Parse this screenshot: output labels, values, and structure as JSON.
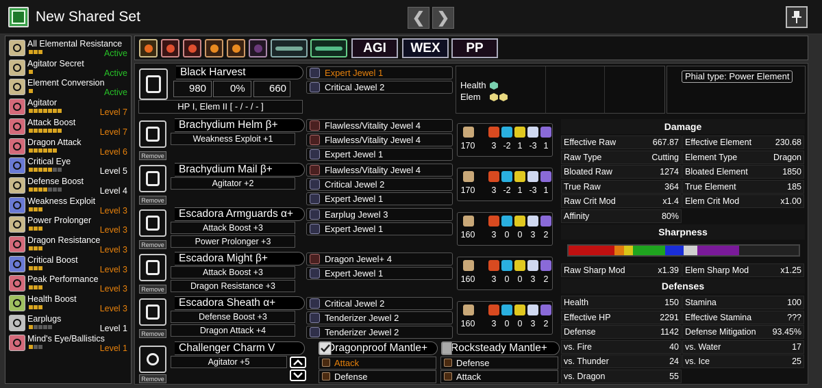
{
  "header": {
    "title": "New Shared Set",
    "prev_label": "❮",
    "next_label": "❯"
  },
  "colors": {
    "active": "#27c127",
    "level": "#e8820c",
    "white": "#ffffff"
  },
  "skills": [
    {
      "name": "All Elemental Resistance",
      "status": "Active",
      "pips": 3,
      "max": 3,
      "icon": "crest-icon",
      "color": "#c9b98a"
    },
    {
      "name": "Agitator Secret",
      "status": "Active",
      "pips": 1,
      "max": 1,
      "icon": "crest-icon",
      "color": "#c9b98a"
    },
    {
      "name": "Element Conversion",
      "status": "Active",
      "pips": 1,
      "max": 1,
      "icon": "crest-icon",
      "color": "#c9b98a"
    },
    {
      "name": "Agitator",
      "status": "Level 7",
      "pips": 7,
      "max": 7,
      "icon": "skill-icon",
      "color": "#d46a7a"
    },
    {
      "name": "Attack Boost",
      "status": "Level 7",
      "pips": 7,
      "max": 7,
      "icon": "skill-icon",
      "color": "#d46a7a"
    },
    {
      "name": "Dragon Attack",
      "status": "Level 6",
      "pips": 6,
      "max": 6,
      "icon": "skill-icon",
      "color": "#d46a7a"
    },
    {
      "name": "Critical Eye",
      "status": "Level 5",
      "pips": 5,
      "max": 7,
      "icon": "skill-icon",
      "color": "#6a7ad4"
    },
    {
      "name": "Defense Boost",
      "status": "Level 4",
      "pips": 4,
      "max": 7,
      "icon": "skill-icon",
      "color": "#c9b98a"
    },
    {
      "name": "Weakness Exploit",
      "status": "Level 3",
      "pips": 3,
      "max": 3,
      "icon": "skill-icon",
      "color": "#6a7ad4"
    },
    {
      "name": "Power Prolonger",
      "status": "Level 3",
      "pips": 3,
      "max": 3,
      "icon": "skill-icon",
      "color": "#c9b98a"
    },
    {
      "name": "Dragon Resistance",
      "status": "Level 3",
      "pips": 3,
      "max": 3,
      "icon": "skill-icon",
      "color": "#d46a7a"
    },
    {
      "name": "Critical Boost",
      "status": "Level 3",
      "pips": 3,
      "max": 3,
      "icon": "skill-icon",
      "color": "#6a7ad4"
    },
    {
      "name": "Peak Performance",
      "status": "Level 3",
      "pips": 3,
      "max": 3,
      "icon": "skill-icon",
      "color": "#d46a7a"
    },
    {
      "name": "Health Boost",
      "status": "Level 3",
      "pips": 3,
      "max": 3,
      "icon": "skill-icon",
      "color": "#a0c060"
    },
    {
      "name": "Earplugs",
      "status": "Level 1",
      "pips": 1,
      "max": 5,
      "icon": "skill-icon",
      "color": "#c0c0c0"
    },
    {
      "name": "Mind's Eye/Ballistics",
      "status": "Level 1",
      "pips": 1,
      "max": 3,
      "icon": "skill-icon",
      "color": "#d46a7a"
    }
  ],
  "tags": [
    "AGI",
    "WEX",
    "PP"
  ],
  "weapon": {
    "name": "Black Harvest",
    "attack": "980",
    "affinity": "0%",
    "element": "660",
    "sharpness_label": "HP I, Elem II [ - / - / - ]",
    "jewels": [
      {
        "label": "Expert Jewel 1",
        "color": "#e8820c"
      },
      {
        "label": "Critical Jewel 2",
        "color": "#ffffff"
      }
    ],
    "health_label": "Health",
    "elem_label": "Elem",
    "phial": "Phial type: Power Element"
  },
  "armor": [
    {
      "name": "Brachydium Helm β+",
      "skills": [
        "Weakness Exploit +1"
      ],
      "jewels": [
        "Flawless/Vitality Jewel 4",
        "Flawless/Vitality Jewel 4",
        "Expert Jewel 1"
      ],
      "res": [
        "170",
        "3",
        "-2",
        "1",
        "-3",
        "1"
      ],
      "remove": "Remove"
    },
    {
      "name": "Brachydium Mail β+",
      "skills": [
        "Agitator +2"
      ],
      "jewels": [
        "Flawless/Vitality Jewel 4",
        "Critical Jewel 2",
        "Expert Jewel 1"
      ],
      "res": [
        "170",
        "3",
        "-2",
        "1",
        "-3",
        "1"
      ],
      "remove": "Remove"
    },
    {
      "name": "Escadora Armguards α+",
      "skills": [
        "Attack Boost +3",
        "Power Prolonger +3"
      ],
      "jewels": [
        "Earplug Jewel 3",
        "Expert Jewel 1"
      ],
      "res": [
        "160",
        "3",
        "0",
        "0",
        "3",
        "2"
      ],
      "remove": "Remove"
    },
    {
      "name": "Escadora Might β+",
      "skills": [
        "Attack Boost +3",
        "Dragon Resistance +3"
      ],
      "jewels": [
        "Dragon Jewel+ 4",
        "Expert Jewel 1"
      ],
      "res": [
        "160",
        "3",
        "0",
        "0",
        "3",
        "2"
      ],
      "remove": "Remove"
    },
    {
      "name": "Escadora Sheath α+",
      "skills": [
        "Defense Boost +3",
        "Dragon Attack +4"
      ],
      "jewels": [
        "Critical Jewel 2",
        "Tenderizer Jewel 2",
        "Tenderizer Jewel 2"
      ],
      "res": [
        "160",
        "3",
        "0",
        "0",
        "3",
        "2"
      ],
      "remove": "Remove"
    }
  ],
  "charm": {
    "name": "Challenger Charm V",
    "skill": "Agitator +5",
    "remove": "Remove"
  },
  "mantles": [
    {
      "name": "Dragonproof Mantle+",
      "items": [
        "Attack",
        "Defense"
      ],
      "color": "#e8820c"
    },
    {
      "name": "Rocksteady Mantle+",
      "items": [
        "Defense",
        "Attack"
      ],
      "color": "#ffffff"
    }
  ],
  "stats": {
    "damage_title": "Damage",
    "damage": [
      [
        "Effective Raw",
        "667.87",
        "Effective Element",
        "230.68"
      ],
      [
        "Raw Type",
        "Cutting",
        "Element Type",
        "Dragon"
      ],
      [
        "Bloated Raw",
        "1274",
        "Bloated Element",
        "1850"
      ],
      [
        "True Raw",
        "364",
        "True Element",
        "185"
      ],
      [
        "Raw Crit Mod",
        "x1.4",
        "Elem Crit Mod",
        "x1.00"
      ],
      [
        "Affinity",
        "80%",
        "",
        ""
      ]
    ],
    "sharpness_title": "Sharpness",
    "sharp_mods": [
      "Raw Sharp Mod",
      "x1.39",
      "Elem Sharp Mod",
      "x1.25"
    ],
    "defenses_title": "Defenses",
    "defenses": [
      [
        "Health",
        "150",
        "Stamina",
        "100"
      ],
      [
        "Effective HP",
        "2291",
        "Effective Stamina",
        "???"
      ],
      [
        "Defense",
        "1142",
        "Defense Mitigation",
        "93.45%"
      ],
      [
        "vs. Fire",
        "40",
        "vs. Water",
        "17"
      ],
      [
        "vs. Thunder",
        "24",
        "vs. Ice",
        "25"
      ],
      [
        "vs. Dragon",
        "55",
        "",
        ""
      ]
    ]
  },
  "sharpness_bar": [
    {
      "color": "#c01010",
      "frac": 0.2
    },
    {
      "color": "#e07b10",
      "frac": 0.04
    },
    {
      "color": "#d8c61a",
      "frac": 0.04
    },
    {
      "color": "#1fa41f",
      "frac": 0.14
    },
    {
      "color": "#1a2ed8",
      "frac": 0.08
    },
    {
      "color": "#cfcfcf",
      "frac": 0.06
    },
    {
      "color": "#7a1a9a",
      "frac": 0.18
    }
  ]
}
